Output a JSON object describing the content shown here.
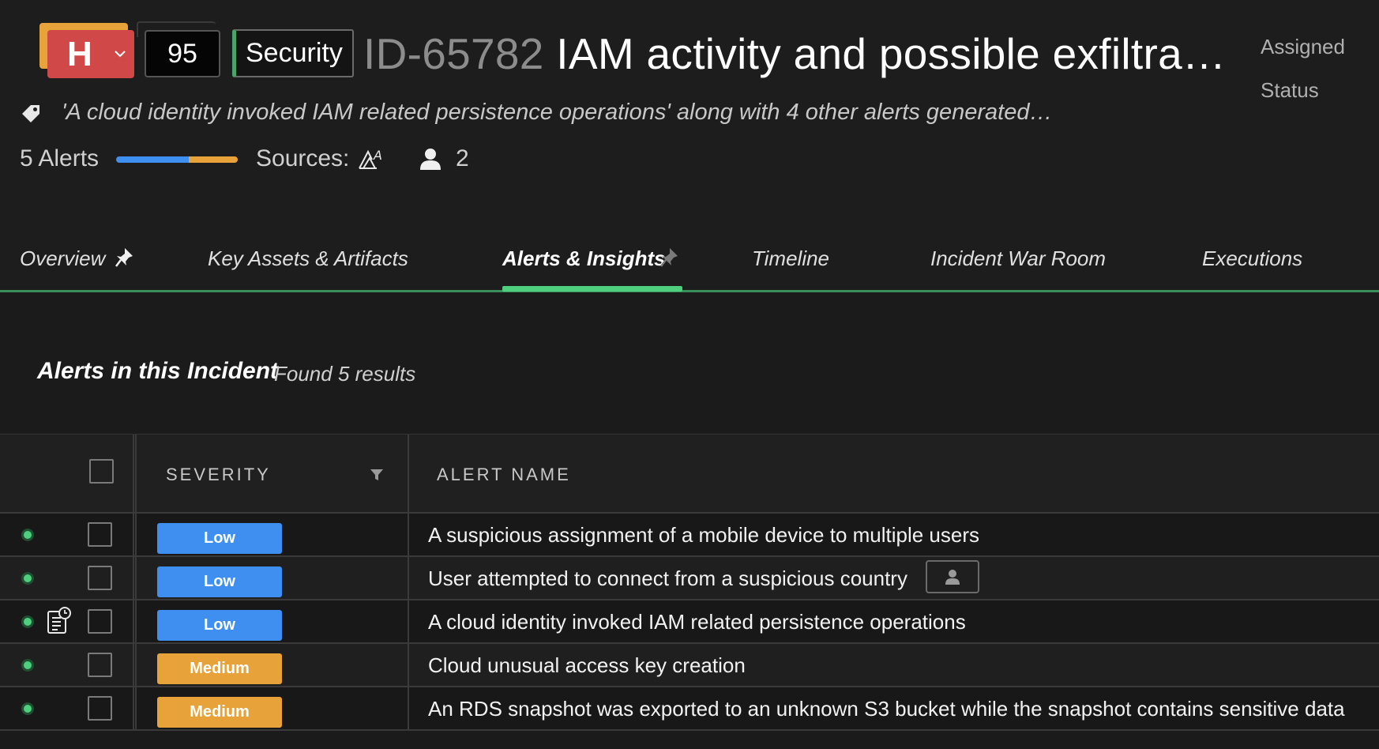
{
  "incident": {
    "severity_letter": "H",
    "score": "95",
    "type": "Security",
    "id": "ID-65782",
    "title": "IAM activity and possible exfiltra…",
    "description": "'A cloud identity invoked IAM related persistence operations' along with 4 other alerts generated…",
    "alerts_count_label": "5 Alerts",
    "sources_label": "Sources:",
    "users_count": "2",
    "alerts_bar": {
      "low": 3,
      "medium": 2,
      "low_color": "#3f8ff0",
      "medium_color": "#e8a23a"
    }
  },
  "side": {
    "assigned_label": "Assigned",
    "status_label": "Status"
  },
  "tabs": [
    {
      "label": "Overview",
      "pinned": true
    },
    {
      "label": "Key Assets & Artifacts"
    },
    {
      "label": "Alerts & Insights",
      "active": true,
      "pin_icon": true
    },
    {
      "label": "Timeline"
    },
    {
      "label": "Incident War Room"
    },
    {
      "label": "Executions"
    }
  ],
  "section": {
    "title": "Alerts in this Incident",
    "count": "Found 5 results"
  },
  "table": {
    "columns": {
      "severity": "SEVERITY",
      "alert_name": "ALERT NAME"
    },
    "rows": [
      {
        "severity": "Low",
        "name": "A suspicious assignment of a mobile device to multiple users"
      },
      {
        "severity": "Low",
        "name": "User attempted to connect from a suspicious country"
      },
      {
        "severity": "Low",
        "name": "A cloud identity invoked IAM related persistence operations"
      },
      {
        "severity": "Medium",
        "name": "Cloud unusual access key creation"
      },
      {
        "severity": "Medium",
        "name": "An RDS snapshot was exported to an unknown S3 bucket while the snapshot contains sensitive data"
      }
    ]
  },
  "colors": {
    "accent_green": "#4fcf7e",
    "severity_high": "#d04848",
    "severity_low": "#3f8ff0",
    "severity_medium": "#e8a23a"
  }
}
